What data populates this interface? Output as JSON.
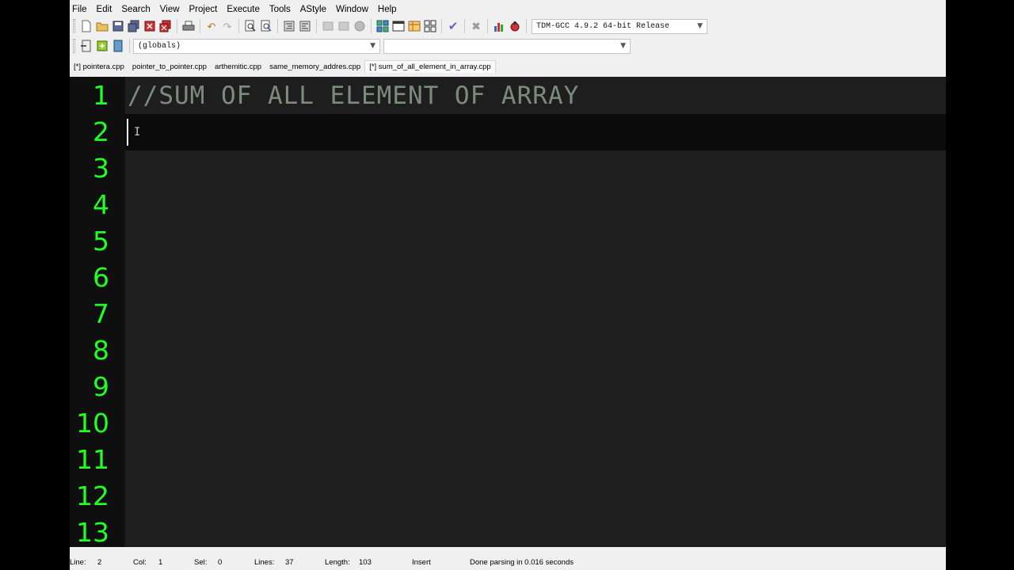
{
  "menu": [
    "File",
    "Edit",
    "Search",
    "View",
    "Project",
    "Execute",
    "Tools",
    "AStyle",
    "Window",
    "Help"
  ],
  "toolbar": {
    "compiler": "TDM-GCC 4.9.2 64-bit Release",
    "scope": "(globals)",
    "member": ""
  },
  "tabs": [
    {
      "label": "[*] pointera.cpp",
      "active": false
    },
    {
      "label": "pointer_to_pointer.cpp",
      "active": false
    },
    {
      "label": "arthemitic.cpp",
      "active": false
    },
    {
      "label": "same_memory_addres.cpp",
      "active": false
    },
    {
      "label": "[*] sum_of_all_element_in_array.cpp",
      "active": true
    }
  ],
  "editor": {
    "line_numbers": [
      "1",
      "2",
      "3",
      "4",
      "5",
      "6",
      "7",
      "8",
      "9",
      "10",
      "11",
      "12",
      "13"
    ],
    "lines": [
      "//SUM OF ALL ELEMENT OF ARRAY",
      ""
    ],
    "current_line": 2
  },
  "status": {
    "line_label": "Line:",
    "line_value": "2",
    "col_label": "Col:",
    "col_value": "1",
    "sel_label": "Sel:",
    "sel_value": "0",
    "lines_label": "Lines:",
    "lines_value": "37",
    "length_label": "Length:",
    "length_value": "103",
    "mode": "Insert",
    "message": "Done parsing in 0.016 seconds"
  },
  "colors": {
    "editor_bg": "#1e1e1e",
    "gutter_bg": "#0f0f0f",
    "line_number": "#22ff22",
    "comment": "#7c8c7c"
  },
  "icons": [
    "new-file-icon",
    "open-icon",
    "save-icon",
    "save-all-icon",
    "close-icon",
    "close-all-icon",
    "print-icon",
    "undo-icon",
    "redo-icon",
    "find-icon",
    "replace-icon",
    "indent-icon",
    "unindent-icon",
    "back-icon",
    "forward-icon",
    "bookmark-icon",
    "new-project-icon",
    "window-icon",
    "class-icon",
    "layout-icon",
    "check-icon",
    "stop-icon",
    "chart-icon",
    "debug-icon"
  ]
}
